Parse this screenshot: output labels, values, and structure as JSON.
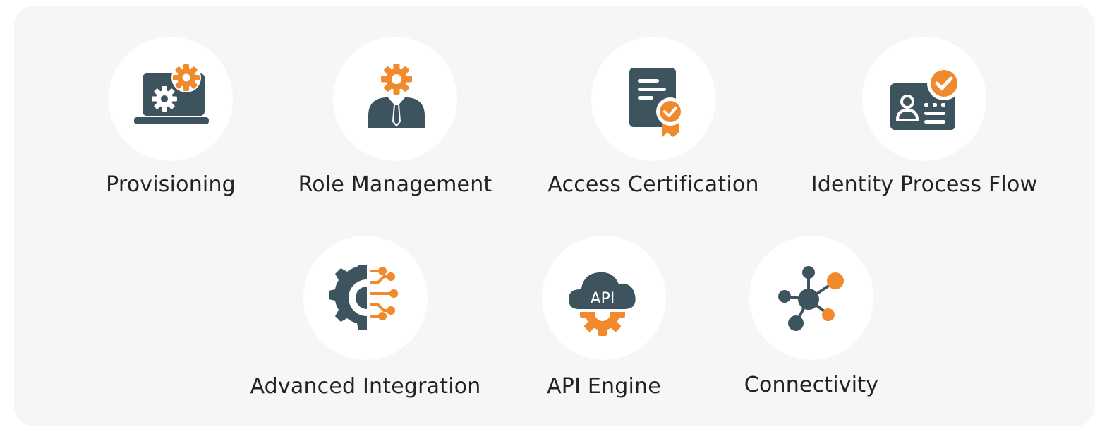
{
  "colors": {
    "primary": "#3d535e",
    "accent": "#f08a2c",
    "circle_bg": "#ffffff",
    "panel_bg": "#f6f6f6",
    "text": "#222222"
  },
  "features_row1": [
    {
      "label": "Provisioning",
      "icon": "laptop-gear-icon"
    },
    {
      "label": "Role Management",
      "icon": "person-gear-icon"
    },
    {
      "label": "Access Certification",
      "icon": "certificate-badge-icon"
    },
    {
      "label": "Identity Process Flow",
      "icon": "id-card-check-icon"
    }
  ],
  "features_row2": [
    {
      "label": "Advanced Integration",
      "icon": "gear-circuit-icon"
    },
    {
      "label": "API Engine",
      "icon": "api-cloud-gear-icon",
      "icon_text": "API"
    },
    {
      "label": "Connectivity",
      "icon": "network-nodes-icon"
    }
  ]
}
